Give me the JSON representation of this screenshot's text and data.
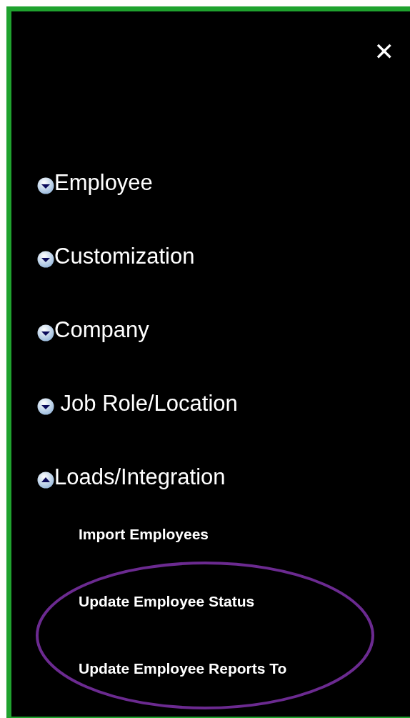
{
  "close_button": {
    "label": "✕"
  },
  "menu": [
    {
      "label": "Employee",
      "expanded": false
    },
    {
      "label": "Customization",
      "expanded": false
    },
    {
      "label": "Company",
      "expanded": false
    },
    {
      "label": " Job Role/Location",
      "expanded": false
    },
    {
      "label": "Loads/Integration",
      "expanded": true,
      "children": [
        {
          "label": "Import Employees",
          "highlighted": false
        },
        {
          "label": "Update Employee Status",
          "highlighted": true
        },
        {
          "label": "Update Employee Reports To",
          "highlighted": true
        }
      ]
    }
  ]
}
